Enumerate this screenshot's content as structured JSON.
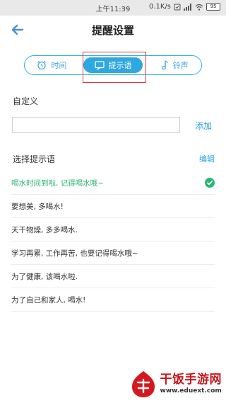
{
  "status_bar": {
    "time": "上午11:39",
    "dots": "...",
    "network_speed": "0.1K/s",
    "battery": "95"
  },
  "header": {
    "title": "提醒设置"
  },
  "tabs": [
    {
      "label": "时间",
      "icon": "alarm-clock-icon",
      "active": false
    },
    {
      "label": "提示语",
      "icon": "message-icon",
      "active": true
    },
    {
      "label": "铃声",
      "icon": "music-note-icon",
      "active": false
    }
  ],
  "custom": {
    "label": "自定义",
    "input_value": "",
    "input_placeholder": "",
    "add_label": "添加"
  },
  "prompts": {
    "section_label": "选择提示语",
    "edit_label": "编辑",
    "items": [
      {
        "text": "喝水时间到啦, 记得喝水哦~",
        "selected": true
      },
      {
        "text": "要想美, 多喝水!",
        "selected": false
      },
      {
        "text": "天干物燥, 多多喝水.",
        "selected": false
      },
      {
        "text": "学习再累, 工作再苦, 也要记得喝水哦~",
        "selected": false
      },
      {
        "text": "为了健康, 该喝水啦.",
        "selected": false
      },
      {
        "text": "为了自己和家人, 喝水!",
        "selected": false
      }
    ]
  },
  "watermark": {
    "title": "干饭手游网",
    "url": "www.eduext.com"
  },
  "colors": {
    "accent": "#2fa7e0",
    "selected": "#2bb673",
    "highlight": "#d93b3b",
    "brand": "#c8161d"
  }
}
